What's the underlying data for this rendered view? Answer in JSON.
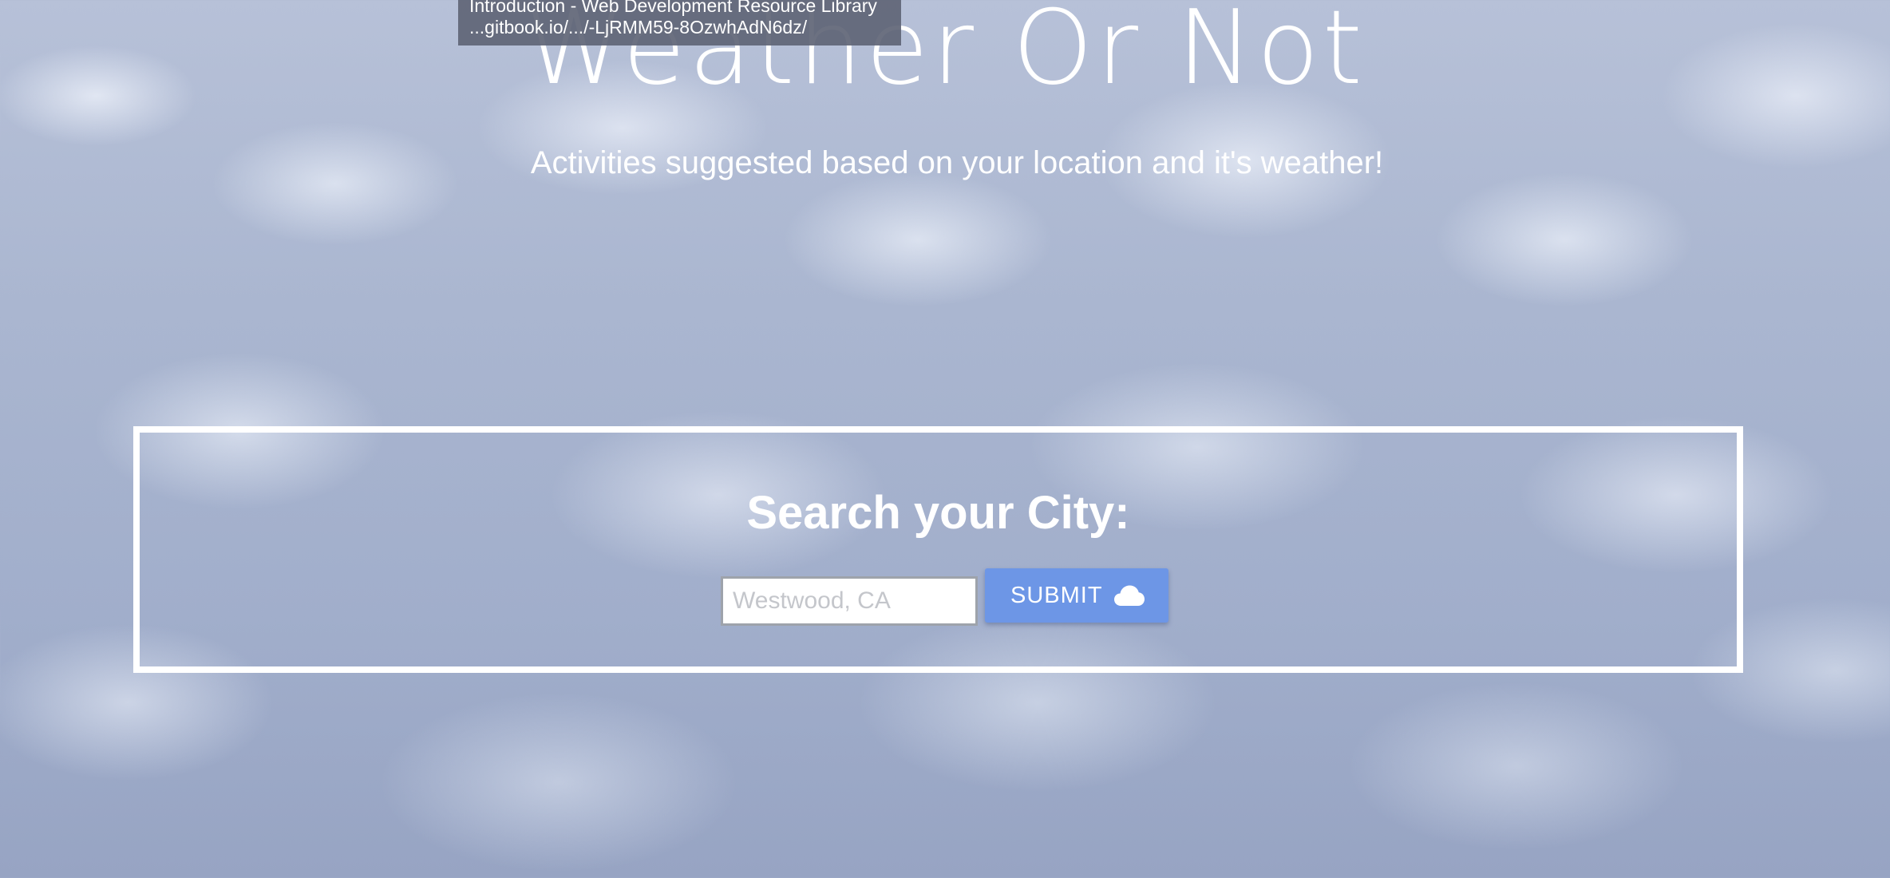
{
  "header": {
    "title": "Weather Or Not",
    "subtitle": "Activities suggested based on your location and it's weather!"
  },
  "search": {
    "heading": "Search your City:",
    "placeholder": "Westwood, CA",
    "value": "",
    "submit_label": "SUBMIT",
    "submit_icon": "cloud-icon",
    "submit_color": "#6d96e6"
  },
  "tooltip": {
    "title": "Introduction - Web Development Resource Library",
    "url": "...gitbook.io/.../-LjRMM59-8OzwhAdN6dz/"
  }
}
